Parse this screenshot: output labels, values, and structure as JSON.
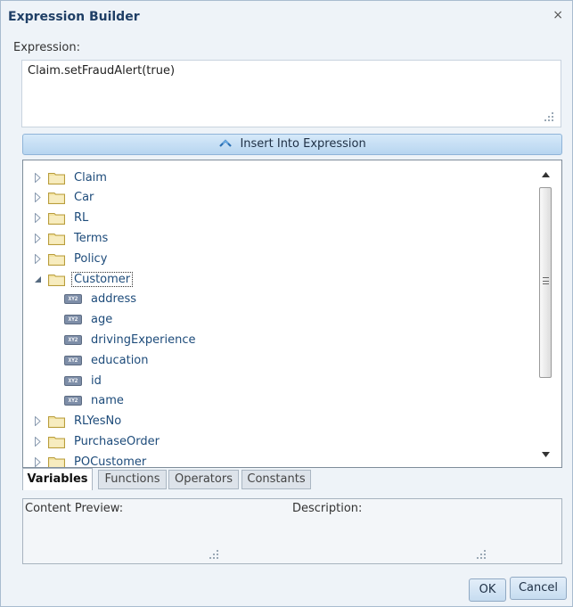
{
  "dialog": {
    "title": "Expression Builder",
    "close_glyph": "×"
  },
  "expression": {
    "label": "Expression:",
    "value": "Claim.setFraudAlert(true)"
  },
  "insert_button": {
    "label": "Insert Into Expression",
    "icon": "chevron-up-double-icon"
  },
  "tree": {
    "folders_before": [
      "Claim",
      "Car",
      "RL",
      "Terms",
      "Policy"
    ],
    "expanded_folder": "Customer",
    "customer_children": [
      "address",
      "age",
      "drivingExperience",
      "education",
      "id",
      "name"
    ],
    "folders_after": [
      "RLYesNo",
      "PurchaseOrder",
      "POCustomer"
    ],
    "variable_icon_text": "XY2"
  },
  "tabs": [
    {
      "label": "Variables",
      "active": true
    },
    {
      "label": "Functions",
      "active": false
    },
    {
      "label": "Operators",
      "active": false
    },
    {
      "label": "Constants",
      "active": false
    }
  ],
  "bottom": {
    "content_preview_label": "Content Preview:",
    "description_label": "Description:"
  },
  "buttons": {
    "ok": "OK",
    "cancel": "Cancel"
  },
  "colors": {
    "tree_label": "#1d4b7a",
    "folder_fill": "#f2e2a0",
    "accent_button": "#b7d5f0"
  }
}
